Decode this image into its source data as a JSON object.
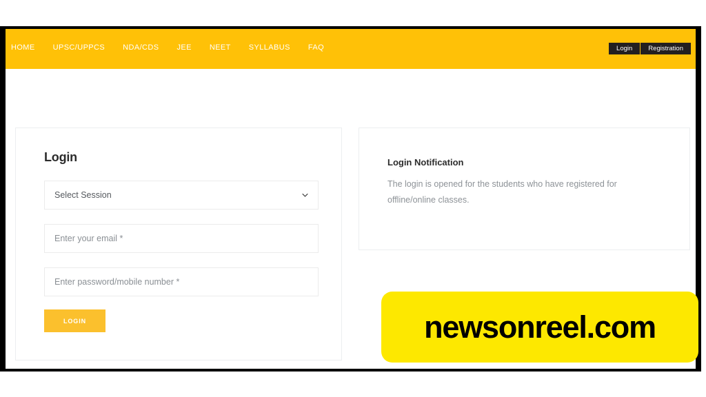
{
  "navbar": {
    "links": [
      {
        "label": "HOME",
        "name": "nav-link-home"
      },
      {
        "label": "UPSC/UPPCS",
        "name": "nav-link-upsc-uppcs"
      },
      {
        "label": "NDA/CDS",
        "name": "nav-link-nda-cds"
      },
      {
        "label": "JEE",
        "name": "nav-link-jee"
      },
      {
        "label": "NEET",
        "name": "nav-link-neet"
      },
      {
        "label": "SYLLABUS",
        "name": "nav-link-syllabus"
      },
      {
        "label": "FAQ",
        "name": "nav-link-faq"
      }
    ],
    "login_button": "Login",
    "registration_button": "Registration",
    "background_color": "#ffc107",
    "button_background_color": "#231f20"
  },
  "login_card": {
    "title": "Login",
    "session_select": {
      "selected": "Select Session",
      "icon": "chevron-down-icon"
    },
    "email_field": {
      "value": "",
      "placeholder": "Enter your email *"
    },
    "password_field": {
      "value": "",
      "placeholder": "Enter password/mobile number *"
    },
    "submit_button": {
      "label": "LOGIN",
      "background_color": "#fbc02d"
    }
  },
  "notification_card": {
    "title": "Login Notification",
    "body": "The login is opened for the students who have registered for offline/online classes."
  },
  "watermark": {
    "text": "newsonreel.com",
    "background_color": "#fde800",
    "text_color": "#000000"
  }
}
